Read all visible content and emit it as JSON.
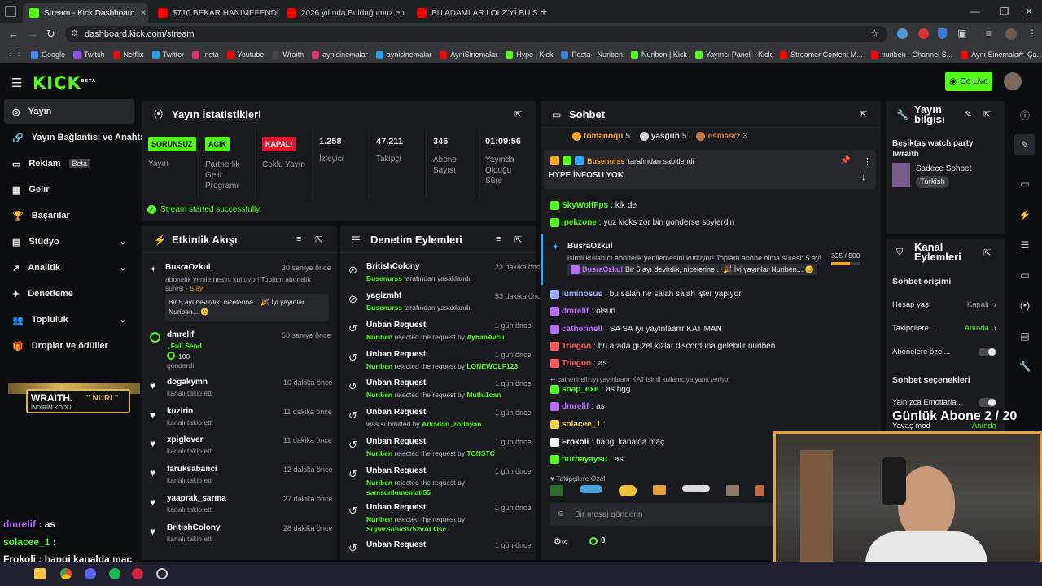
{
  "browser": {
    "tabs": [
      {
        "label": "Stream - Kick Dashboard",
        "icon": "kick-icon"
      },
      {
        "label": "$710 BEKAR HANIMEFENDİNİN",
        "icon": "youtube-icon"
      },
      {
        "label": "2026 yılında Bulduğumuz en iy",
        "icon": "youtube-icon"
      },
      {
        "label": "BU ADAMLAR LOL2\"Yİ BU SEFER",
        "icon": "youtube-icon"
      }
    ],
    "url": "dashboard.kick.com/stream",
    "bookmarks": [
      "Google",
      "Twitch",
      "Netflix",
      "Twitter",
      "Insta",
      "Youtube",
      "Wraith",
      "aynisinemalar",
      "aynisinemalar",
      "AyniSinemalar",
      "Hype | Kick",
      "Posta - Nuriben",
      "Nuriben | Kick",
      "Yayıncı Paneli | Kick",
      "Streamer Content M...",
      "nuriben - Channel S...",
      "Aynı Sinemalar - Ça..."
    ]
  },
  "header": {
    "logo": "KICK",
    "logo_sup": "BETA",
    "go_live": "Go Live"
  },
  "sidebar": {
    "items": [
      "Yayın",
      "Yayın Bağlantısı ve Anahtarı",
      "Reklam",
      "Gelir",
      "Başarılar",
      "Stüdyo",
      "Analitik",
      "Denetleme",
      "Topluluk",
      "Droplar ve ödüller"
    ],
    "beta": "Beta"
  },
  "promo": {
    "brand": "WRAITH.",
    "name": "\" NURI \"",
    "code_label": "İNDİRİM KODU:"
  },
  "stats": {
    "title": "Yayın İstatistikleri",
    "cards": [
      {
        "badge": "SORUNSUZ",
        "label": "Yayın",
        "color": "#53fc18"
      },
      {
        "badge": "AÇIK",
        "label": "Partnerlik Gelir Programı",
        "color": "#53fc18"
      },
      {
        "badge": "KAPALI",
        "label": "Çoklu Yayın",
        "color": "#e0142a"
      },
      {
        "value": "1.258",
        "label": "İzleyici"
      },
      {
        "value": "47.211",
        "label": "Takipçi"
      },
      {
        "value": "346",
        "label": "Abone Sayısı"
      },
      {
        "value": "01:09:56",
        "label": "Yayında Olduğu Süre"
      }
    ],
    "status": "Stream started successfully."
  },
  "activity": {
    "title": "Etkinlik Akışı",
    "sub_event": {
      "name": "BusraOzkul",
      "time": "30 saniye önce",
      "text": "abonelik yenilemesini kutluyor! Toplam abonelik süresi - ",
      "months": "5 ay!",
      "message": "Bir 5 ayı devirdik, nicelerine... 🎉 İyi yayınlar Nuriben... 😊"
    },
    "send_event": {
      "name": "dmrelif",
      "time": "50 saniye önce",
      "action": ", Full Send",
      "amount": "100",
      "sent": "gönderdi"
    },
    "follows": [
      {
        "name": "dogakymn",
        "time": "10 dakika önce",
        "text": "kanalı takip etti"
      },
      {
        "name": "kuzirin",
        "time": "11 dakika önce",
        "text": "kanalı takip etti"
      },
      {
        "name": "xpiglover",
        "time": "11 dakika önce",
        "text": "kanalı takip etti"
      },
      {
        "name": "faruksabanci",
        "time": "12 dakika önce",
        "text": "kanalı takip etti"
      },
      {
        "name": "yaaprak_sarma",
        "time": "27 dakika önce",
        "text": "kanalı takip etti"
      },
      {
        "name": "BritishColony",
        "time": "28 dakika önce",
        "text": "kanalı takip etti"
      }
    ]
  },
  "moderation": {
    "title": "Denetim Eylemleri",
    "items": [
      {
        "title": "BritishColony",
        "time": "23 dakika önce",
        "actor": "Busenurss",
        "text": "tarafından yasaklandı",
        "target": "",
        "icon": "ban-icon"
      },
      {
        "title": "yagizmht",
        "time": "53 dakika önce",
        "actor": "Busenurss",
        "text": "tarafından yasaklandı",
        "target": "",
        "icon": "ban-icon"
      },
      {
        "title": "Unban Request",
        "time": "1 gün önce",
        "actor": "Nuriben",
        "text": "rejected the request by",
        "target": "AyhanAvcu",
        "icon": "history-icon"
      },
      {
        "title": "Unban Request",
        "time": "1 gün önce",
        "actor": "Nuriben",
        "text": "rejected the request by",
        "target": "LONEWOLF123",
        "icon": "history-icon"
      },
      {
        "title": "Unban Request",
        "time": "1 gün önce",
        "actor": "Nuriben",
        "text": "rejected the request by",
        "target": "Mutlu1can",
        "icon": "history-icon"
      },
      {
        "title": "Unban Request",
        "time": "1 gün önce",
        "actor": "",
        "text": "was submitted by",
        "target": "Arkadan_zorlayan",
        "icon": "history-icon"
      },
      {
        "title": "Unban Request",
        "time": "1 gün önce",
        "actor": "Nuriben",
        "text": "rejected the request by",
        "target": "TCNSTC",
        "icon": "history-icon"
      },
      {
        "title": "Unban Request",
        "time": "1 gün önce",
        "actor": "Nuriben",
        "text": "rejected the request by",
        "target": "samsunlumemati55",
        "icon": "history-icon"
      },
      {
        "title": "Unban Request",
        "time": "1 gün önce",
        "actor": "Nuriben",
        "text": "rejected the request by",
        "target": "SuperSonic0752vALOsc",
        "icon": "history-icon"
      },
      {
        "title": "Unban Request",
        "time": "1 gün önce",
        "actor": "",
        "text": "",
        "target": "",
        "icon": "history-icon"
      }
    ]
  },
  "chat": {
    "title": "Sohbet",
    "top_gifters": [
      {
        "name": "tomanoqu",
        "n": "5"
      },
      {
        "name": "yasgun",
        "n": "5"
      },
      {
        "name": "esmasrz",
        "n": "3"
      }
    ],
    "pinned": {
      "by": "Busenurss",
      "by_text": "tarafından sabitlendi",
      "message": "HYPE İNFOSU YOK"
    },
    "lines1": [
      {
        "user": "SkyWolfFps",
        "color": "#53fc18",
        "text": "kik de"
      },
      {
        "user": "ipekzone",
        "color": "#53fc18",
        "text": "yuz kicks zor bin gonderse soylerdin"
      }
    ],
    "sub": {
      "user": "BusraOzkul",
      "text": "isimli kullanıcı abonelik yenilemesini kutluyor! Toplam abone olma süresi: 5 ay!",
      "progress": "325 / 500",
      "progress_frac": 0.65,
      "reply_user": "BusraOzkul",
      "reply_text": "Bir 5 ayı devirdik, nicelerine... 🎉 İyi yayınlar Nuriben... 😊"
    },
    "lines2": [
      {
        "user": "luminosus",
        "color": "#9ba6ff",
        "text": "bu salah ne salah salah işler yapıyor"
      },
      {
        "user": "dmrelif",
        "color": "#b86bff",
        "text": "olsun"
      },
      {
        "user": "catherinell",
        "color": "#b86bff",
        "text": "SA SA ıyı yayınlaarrr KAT MAN"
      },
      {
        "user": "Triegoo",
        "color": "#ff5a5a",
        "text": "bu arada guzel kizlar discorduna gelebilir nuriben"
      },
      {
        "user": "Triegoo",
        "color": "#ff5a5a",
        "text": "as"
      }
    ],
    "reply_hint": {
      "user": "catherinell",
      "text": "ıyı yayınlaarrr KAT  isimli kullanıcıya yanıt veriyor"
    },
    "lines3": [
      {
        "user": "snap_exe",
        "color": "#53fc18",
        "text": "as hgg"
      },
      {
        "user": "dmrelif",
        "color": "#b86bff",
        "text": "as"
      },
      {
        "user": "solacee_1",
        "color": "#f5d547",
        "text": ""
      },
      {
        "user": "Frokoli",
        "color": "#ffffff",
        "text": "hangi kanalda maç"
      },
      {
        "user": "hurbayaysu",
        "color": "#53fc18",
        "text": "as"
      }
    ],
    "emote_label": "Takipçilere Özel",
    "placeholder": "Bir mesaj gönderin",
    "points": "0"
  },
  "stream_info": {
    "title": "Yayın bilgisi",
    "stream_title": "Beşiktaş watch party !wraith",
    "category": "Sadece Sohbet",
    "tag": "Turkish"
  },
  "channel_actions": {
    "title": "Kanal Eylemleri",
    "access": "Sohbet erişimi",
    "rows": [
      {
        "label": "Hesap yaşı",
        "value": "Kapalı"
      },
      {
        "label": "Takipçilere...",
        "value": "Anında"
      },
      {
        "label": "Abonelere özel...",
        "value": ""
      }
    ],
    "options": "Sohbet seçenekleri",
    "emote_only": "Yalnızca Emotlarla...",
    "slow": "Yavaş mod",
    "slow_value": "Anında"
  },
  "overlay": {
    "sub_goal": "Günlük Abone 2 / 20",
    "chat": [
      {
        "user": "dmrelif",
        "text": "as",
        "color": "#b86bff"
      },
      {
        "user": "solacee_1",
        "text": "",
        "color": "#53fc18"
      },
      {
        "user": "Frokoli",
        "text": "hangi kanalda maç",
        "color": "#ffffff"
      },
      {
        "user": "hurbayaysu",
        "text": "as",
        "color": "#53fc18"
      }
    ]
  }
}
